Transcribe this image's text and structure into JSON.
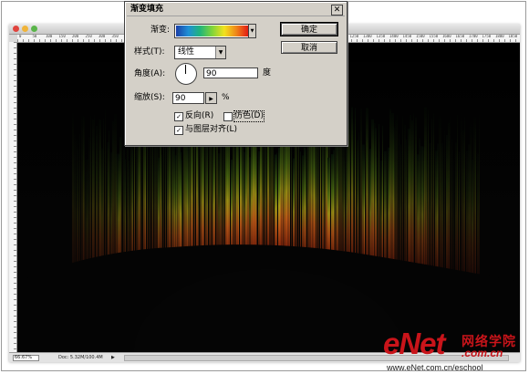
{
  "document": {
    "ruler_ticks": [
      "0",
      "50",
      "100",
      "150",
      "200",
      "250",
      "300",
      "350",
      "400",
      "450",
      "500",
      "550",
      "600",
      "650",
      "700",
      "750",
      "800",
      "850",
      "900",
      "950",
      "1000",
      "1050",
      "1100",
      "1150",
      "1200",
      "1250",
      "1300",
      "1350",
      "1400",
      "1450",
      "1500",
      "1550",
      "1600",
      "1650",
      "1700",
      "1750",
      "1800",
      "1850"
    ],
    "status": {
      "zoom": "66.67%",
      "doc_info": "Doc: 5.32M/100.4M",
      "arrow": "▶"
    }
  },
  "dialog": {
    "title": "渐变填充",
    "close_glyph": "✕",
    "gradient_label": "渐变:",
    "style_label": "样式(T):",
    "style_value": "线性",
    "angle_label": "角度(A):",
    "angle_value": "90",
    "angle_unit": "度",
    "scale_label": "缩放(S):",
    "scale_value": "90",
    "scale_unit": "%",
    "reverse_label": "反向(R)",
    "reverse_checked": true,
    "dither_label": "仿色(D)",
    "dither_checked": false,
    "align_label": "与图层对齐(L)",
    "align_checked": true,
    "ok_label": "确定",
    "cancel_label": "取消",
    "gradient_colors": [
      "#1b3fa8",
      "#1f8fd6",
      "#20b47c",
      "#7fd43a",
      "#f2e21e",
      "#f08a1a",
      "#e21b14"
    ]
  },
  "watermark": {
    "brand": "eNet",
    "chinese": "网络学院",
    "dotcom": ".com.cn",
    "url": "www.eNet.com.cn/eschool"
  },
  "icons": {
    "close": "close-icon",
    "dropdown": "chevron-down-icon",
    "flyout": "triangle-right-icon",
    "check": "checkmark-icon"
  }
}
